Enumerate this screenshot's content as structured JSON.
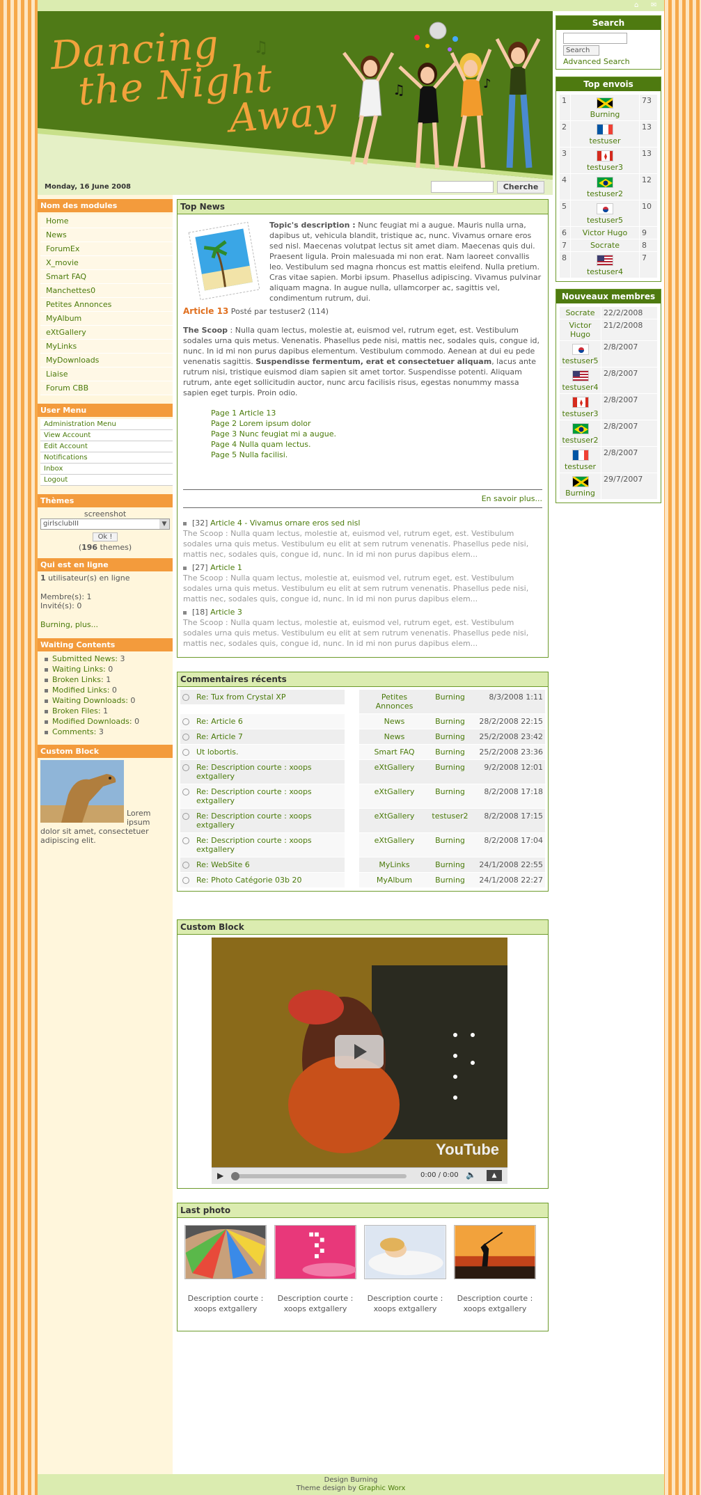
{
  "banner": {
    "title_line1": "Dancing",
    "title_line2": "the Night",
    "title_line3": "Away",
    "date": "Monday, 16 June 2008",
    "search_button": "Cherche"
  },
  "left": {
    "modules_title": "Nom des modules",
    "modules": [
      "Home",
      "News",
      "ForumEx",
      "X_movie",
      "Smart FAQ",
      "Manchettes0",
      "Petites Annonces",
      "MyAlbum",
      "eXtGallery",
      "MyLinks",
      "MyDownloads",
      "Liaise",
      "Forum CBB"
    ],
    "user_menu_title": "User Menu",
    "user_menu": [
      "Administration Menu",
      "View Account",
      "Edit Account",
      "Notifications",
      "Inbox",
      "Logout"
    ],
    "themes_title": "Thèmes",
    "themes_screenshot": "screenshot",
    "themes_selected": "girlsclubIII",
    "themes_ok": "Ok !",
    "themes_count_prefix": "(",
    "themes_count": "196",
    "themes_count_suffix": " themes)",
    "online_title": "Qui est en ligne",
    "online_count": "1",
    "online_text": " utilisateur(s) en ligne",
    "members_text": "Membre(s): 1",
    "guests_text": "Invité(s): 0",
    "online_names": "Burning, plus...",
    "waiting_title": "Waiting Contents",
    "waiting": [
      {
        "label": "Submitted News:",
        "count": "3"
      },
      {
        "label": "Waiting Links:",
        "count": "0"
      },
      {
        "label": "Broken Links:",
        "count": "1"
      },
      {
        "label": "Modified Links:",
        "count": "0"
      },
      {
        "label": "Waiting Downloads:",
        "count": "0"
      },
      {
        "label": "Broken Files:",
        "count": "1"
      },
      {
        "label": "Modified Downloads:",
        "count": "0"
      },
      {
        "label": "Comments:",
        "count": "3"
      }
    ],
    "custom_title": "Custom Block",
    "custom_text": "Lorem ipsum dolor sit amet, consectetuer adipiscing elit."
  },
  "topnews": {
    "title": "Top News",
    "desc_label": "Topic's description :",
    "desc_text": " Nunc feugiat mi a augue. Mauris nulla urna, dapibus ut, vehicula blandit, tristique ac, nunc. Vivamus ornare eros sed nisl. Maecenas volutpat lectus sit amet diam. Maecenas quis dui. Praesent ligula. Proin malesuada mi non erat. Nam laoreet convallis leo. Vestibulum sed magna rhoncus est mattis eleifend. Nulla pretium. Cras vitae sapien. Morbi ipsum. Phasellus adipiscing. Vivamus pulvinar aliquam magna. In augue nulla, ullamcorper ac, sagittis vel, condimentum rutrum, dui.",
    "article_title": "Article 13",
    "article_meta": " Posté par testuser2 (114)",
    "scoop_label": "The Scoop",
    "scoop_text1": " : Nulla quam lectus, molestie at, euismod vel, rutrum eget, est. Vestibulum sodales urna quis metus. Venenatis. Phasellus pede nisi, mattis nec, sodales quis, congue id, nunc. In id mi non purus dapibus elementum. Vestibulum commodo. Aenean at dui eu pede venenatis sagittis. ",
    "scoop_bold": "Suspendisse fermentum, erat et consectetuer aliquam",
    "scoop_text2": ", lacus ante rutrum nisi, tristique euismod diam sapien sit amet tortor. Suspendisse potenti. Aliquam rutrum, ante eget sollicitudin auctor, nunc arcu facilisis risus, egestas nonummy massa sapien eget turpis. Proin odio.",
    "pages": [
      "Page 1 Article 13",
      "Page 2 Lorem ipsum dolor",
      "Page 3 Nunc feugiat mi a augue.",
      "Page 4 Nulla quam lectus.",
      "Page 5 Nulla facilisi."
    ],
    "read_more": "En savoir plus...",
    "list": [
      {
        "count": "[32]",
        "title": "Article 4 - Vivamus ornare eros sed nisl",
        "excerpt": "The Scoop : Nulla quam lectus, molestie at, euismod vel, rutrum eget, est. Vestibulum sodales urna quis metus. Vestibulum eu elit at sem rutrum venenatis. Phasellus pede nisi, mattis nec, sodales quis, congue id, nunc. In id mi non purus dapibus elem..."
      },
      {
        "count": "[27]",
        "title": "Article 1",
        "excerpt": "The Scoop : Nulla quam lectus, molestie at, euismod vel, rutrum eget, est. Vestibulum sodales urna quis metus. Vestibulum eu elit at sem rutrum venenatis. Phasellus pede nisi, mattis nec, sodales quis, congue id, nunc. In id mi non purus dapibus elem..."
      },
      {
        "count": "[18]",
        "title": "Article 3",
        "excerpt": "The Scoop : Nulla quam lectus, molestie at, euismod vel, rutrum eget, est. Vestibulum sodales urna quis metus. Vestibulum eu elit at sem rutrum venenatis. Phasellus pede nisi, mattis nec, sodales quis, congue id, nunc. In id mi non purus dapibus elem..."
      }
    ]
  },
  "comments": {
    "title": "Commentaires récents",
    "rows": [
      {
        "title": "Re: Tux from Crystal XP",
        "module": "Petites Annonces",
        "user": "Burning",
        "date": "8/3/2008 1:11"
      },
      {
        "title": "Re: Article 6",
        "module": "News",
        "user": "Burning",
        "date": "28/2/2008 22:15"
      },
      {
        "title": "Re: Article 7",
        "module": "News",
        "user": "Burning",
        "date": "25/2/2008 23:42"
      },
      {
        "title": "Ut lobortis.",
        "module": "Smart FAQ",
        "user": "Burning",
        "date": "25/2/2008 23:36"
      },
      {
        "title": "Re: Description courte : xoops extgallery",
        "module": "eXtGallery",
        "user": "Burning",
        "date": "9/2/2008 12:01"
      },
      {
        "title": "Re: Description courte : xoops extgallery",
        "module": "eXtGallery",
        "user": "Burning",
        "date": "8/2/2008 17:18"
      },
      {
        "title": "Re: Description courte : xoops extgallery",
        "module": "eXtGallery",
        "user": "testuser2",
        "date": "8/2/2008 17:15"
      },
      {
        "title": "Re: Description courte : xoops extgallery",
        "module": "eXtGallery",
        "user": "Burning",
        "date": "8/2/2008 17:04"
      },
      {
        "title": "Re: WebSite 6",
        "module": "MyLinks",
        "user": "Burning",
        "date": "24/1/2008 22:55"
      },
      {
        "title": "Re: Photo Catégorie 03b 20",
        "module": "MyAlbum",
        "user": "Burning",
        "date": "24/1/2008 22:27"
      }
    ]
  },
  "video": {
    "title": "Custom Block",
    "time": "0:00 / 0:00",
    "brand": "YouTube"
  },
  "photos": {
    "title": "Last photo",
    "items": [
      {
        "caption": "Description courte : xoops extgallery"
      },
      {
        "caption": "Description courte : xoops extgallery"
      },
      {
        "caption": "Description courte : xoops extgallery"
      },
      {
        "caption": "Description courte : xoops extgallery"
      }
    ]
  },
  "right": {
    "search_title": "Search",
    "search_button": "Search",
    "advanced": "Advanced Search",
    "top_title": "Top envois",
    "top": [
      {
        "rank": "1",
        "name": "Burning",
        "count": "73",
        "flag": "jamaica"
      },
      {
        "rank": "2",
        "name": "testuser",
        "count": "13",
        "flag": "france"
      },
      {
        "rank": "3",
        "name": "testuser3",
        "count": "13",
        "flag": "canada"
      },
      {
        "rank": "4",
        "name": "testuser2",
        "count": "12",
        "flag": "brazil"
      },
      {
        "rank": "5",
        "name": "testuser5",
        "count": "10",
        "flag": "korea"
      },
      {
        "rank": "6",
        "name": "Victor Hugo",
        "count": "9",
        "flag": ""
      },
      {
        "rank": "7",
        "name": "Socrate",
        "count": "8",
        "flag": ""
      },
      {
        "rank": "8",
        "name": "testuser4",
        "count": "7",
        "flag": "usa"
      }
    ],
    "members_title": "Nouveaux membres",
    "members": [
      {
        "name": "Socrate",
        "date": "22/2/2008",
        "flag": ""
      },
      {
        "name": "Victor Hugo",
        "date": "21/2/2008",
        "flag": ""
      },
      {
        "name": "testuser5",
        "date": "2/8/2007",
        "flag": "korea"
      },
      {
        "name": "testuser4",
        "date": "2/8/2007",
        "flag": "usa"
      },
      {
        "name": "testuser3",
        "date": "2/8/2007",
        "flag": "canada"
      },
      {
        "name": "testuser2",
        "date": "2/8/2007",
        "flag": "brazil"
      },
      {
        "name": "testuser",
        "date": "2/8/2007",
        "flag": "france"
      },
      {
        "name": "Burning",
        "date": "29/7/2007",
        "flag": "jamaica"
      }
    ]
  },
  "footer": {
    "line1": "Design Burning",
    "line2_prefix": "Theme design by ",
    "line2_link": "Graphic Worx"
  }
}
